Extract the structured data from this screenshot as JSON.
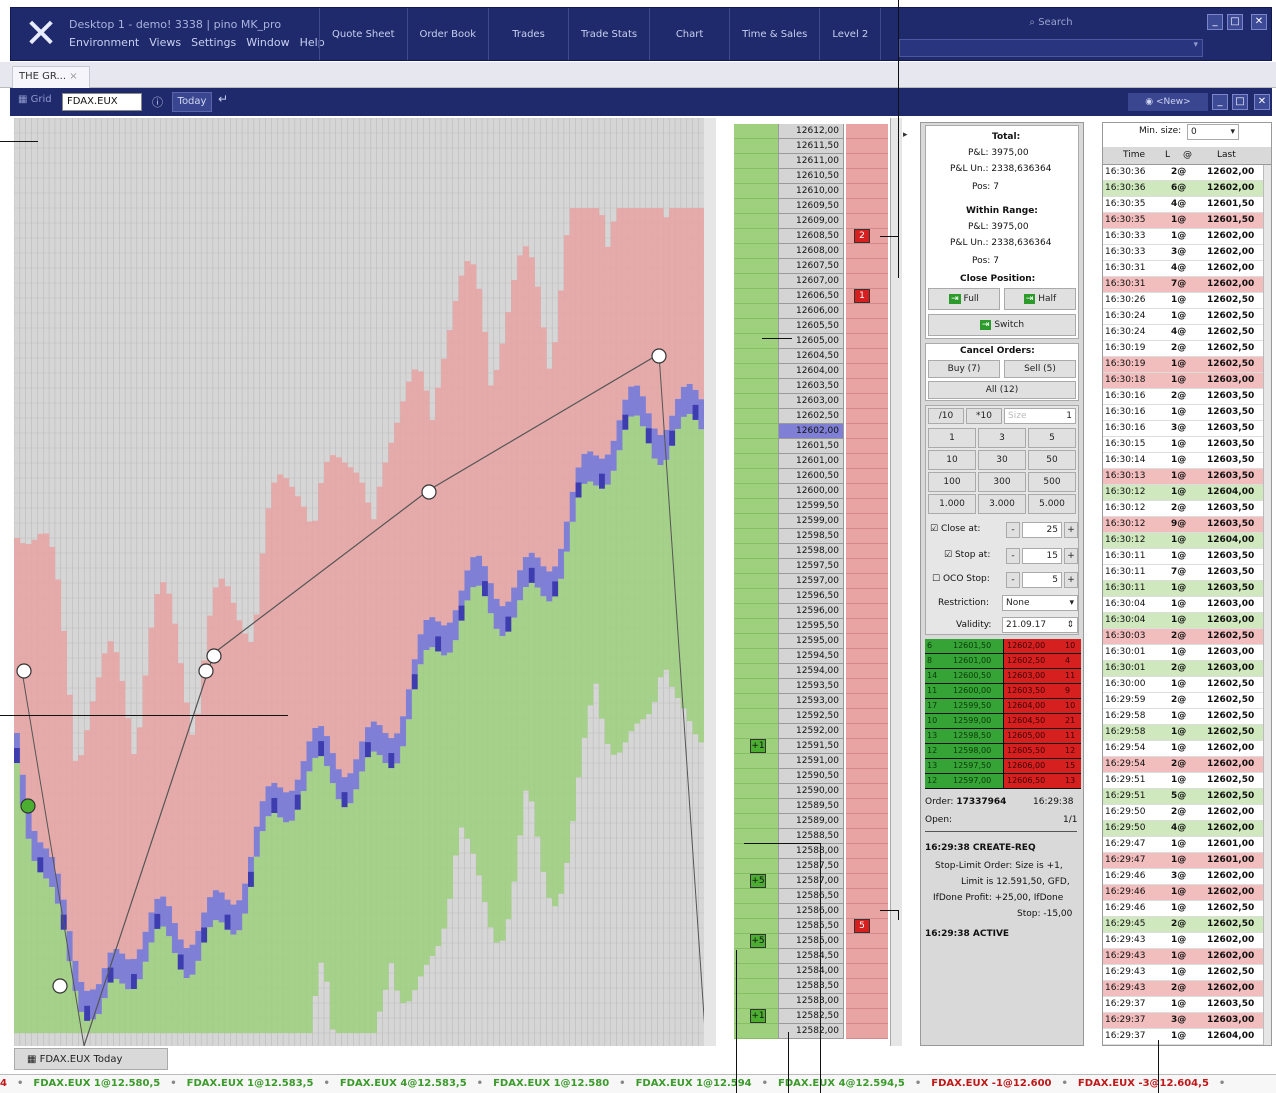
{
  "window": {
    "title": "Desktop 1 - demo! 3338 | pino MK_pro",
    "menu": [
      "Environment",
      "Views",
      "Settings",
      "Window",
      "Help"
    ],
    "buttons": [
      "Quote Sheet",
      "Order Book",
      "Trades",
      "Trade Stats",
      "Chart",
      "Time & Sales",
      "Level 2"
    ],
    "search_label": "Search"
  },
  "tab": {
    "label": "THE GR..."
  },
  "toolbar": {
    "grid_label": "Grid",
    "symbol": "FDAX.EUX",
    "today": "Today",
    "view": "<New>"
  },
  "ladder": {
    "prices": [
      "12612,00",
      "12611,50",
      "12611,00",
      "12610,50",
      "12610,00",
      "12609,50",
      "12609,00",
      "12608,50",
      "12608,00",
      "12607,50",
      "12607,00",
      "12606,50",
      "12606,00",
      "12605,50",
      "12605,00",
      "12604,50",
      "12604,00",
      "12603,50",
      "12603,00",
      "12602,50",
      "12602,00",
      "12601,50",
      "12601,00",
      "12600,50",
      "12600,00",
      "12599,50",
      "12599,00",
      "12598,50",
      "12598,00",
      "12597,50",
      "12597,00",
      "12596,50",
      "12596,00",
      "12595,50",
      "12595,00",
      "12594,50",
      "12594,00",
      "12593,50",
      "12593,00",
      "12592,50",
      "12592,00",
      "12591,50",
      "12591,00",
      "12590,50",
      "12590,00",
      "12589,50",
      "12589,00",
      "12588,50",
      "12588,00",
      "12587,50",
      "12587,00",
      "12586,50",
      "12586,00",
      "12585,50",
      "12585,00",
      "12584,50",
      "12584,00",
      "12583,50",
      "12583,00",
      "12582,50",
      "12582,00"
    ],
    "current_index": 20,
    "sell_markers": [
      {
        "row": 7,
        "label": "2"
      },
      {
        "row": 11,
        "label": "1"
      },
      {
        "row": 53,
        "label": "5"
      }
    ],
    "buy_markers": [
      {
        "row": 41,
        "label": "+1"
      },
      {
        "row": 50,
        "label": "+5"
      },
      {
        "row": 54,
        "label": "+5"
      },
      {
        "row": 59,
        "label": "+1"
      }
    ]
  },
  "panel": {
    "total_title": "Total:",
    "total_pnl": "P&L: 3975,00",
    "total_pnl_un": "P&L Un.: 2338,636364",
    "total_pos": "Pos: 7",
    "range_title": "Within Range:",
    "range_pnl": "P&L: 3975,00",
    "range_pnl_un": "P&L Un.: 2338,636364",
    "range_pos": "Pos: 7",
    "close_title": "Close Position:",
    "full": "Full",
    "half": "Half",
    "switch": "Switch",
    "cancel_title": "Cancel Orders:",
    "buy": "Buy (7)",
    "sell": "Sell (5)",
    "all": "All (12)",
    "qty_top": [
      "/10",
      "*10",
      "Size",
      "1"
    ],
    "qty": [
      "1",
      "3",
      "5",
      "10",
      "30",
      "50",
      "100",
      "300",
      "500",
      "1.000",
      "3.000",
      "5.000"
    ],
    "close_at": "Close at:",
    "close_at_val": "25",
    "stop_at": "Stop at:",
    "stop_at_val": "15",
    "oco_stop": "OCO Stop:",
    "oco_val": "5",
    "restriction": "Restriction:",
    "restriction_val": "None",
    "validity": "Validity:",
    "validity_val": "21.09.17",
    "book": [
      [
        "6",
        "12601,50",
        "12602,00",
        "10"
      ],
      [
        "8",
        "12601,00",
        "12602,50",
        "4"
      ],
      [
        "14",
        "12600,50",
        "12603,00",
        "11"
      ],
      [
        "11",
        "12600,00",
        "12603,50",
        "9"
      ],
      [
        "17",
        "12599,50",
        "12604,00",
        "10"
      ],
      [
        "10",
        "12599,00",
        "12604,50",
        "21"
      ],
      [
        "13",
        "12598,50",
        "12605,00",
        "11"
      ],
      [
        "12",
        "12598,00",
        "12605,50",
        "12"
      ],
      [
        "13",
        "12597,50",
        "12606,00",
        "15"
      ],
      [
        "12",
        "12597,00",
        "12606,50",
        "13"
      ]
    ],
    "order_label": "Order:",
    "order_id": "17337964",
    "order_time": "16:29:38",
    "open_label": "Open:",
    "open_val": "1/1",
    "log": [
      "16:29:38 CREATE-REQ",
      "Stop-Limit Order: Size is +1,",
      "Limit is 12.591,50, GFD,",
      "IfDone Profit: +25,00, IfDone",
      "Stop: -15,00",
      "16:29:38 ACTIVE"
    ]
  },
  "tas": {
    "min_size_label": "Min. size:",
    "min_size_val": "0",
    "headers": [
      "Time",
      "L",
      "@",
      "Last"
    ],
    "rows": [
      [
        "16:30:36",
        "2@",
        "12602,00",
        "w"
      ],
      [
        "16:30:36",
        "6@",
        "12602,00",
        "g"
      ],
      [
        "16:30:35",
        "4@",
        "12601,50",
        "w"
      ],
      [
        "16:30:35",
        "1@",
        "12601,50",
        "r"
      ],
      [
        "16:30:33",
        "1@",
        "12602,00",
        "w"
      ],
      [
        "16:30:33",
        "3@",
        "12602,00",
        "w"
      ],
      [
        "16:30:31",
        "4@",
        "12602,00",
        "w"
      ],
      [
        "16:30:31",
        "7@",
        "12602,00",
        "r"
      ],
      [
        "16:30:26",
        "1@",
        "12602,50",
        "w"
      ],
      [
        "16:30:24",
        "1@",
        "12602,50",
        "w"
      ],
      [
        "16:30:24",
        "4@",
        "12602,50",
        "w"
      ],
      [
        "16:30:19",
        "2@",
        "12602,50",
        "w"
      ],
      [
        "16:30:19",
        "1@",
        "12602,50",
        "r"
      ],
      [
        "16:30:18",
        "1@",
        "12603,00",
        "r"
      ],
      [
        "16:30:16",
        "2@",
        "12603,50",
        "w"
      ],
      [
        "16:30:16",
        "1@",
        "12603,50",
        "w"
      ],
      [
        "16:30:16",
        "3@",
        "12603,50",
        "w"
      ],
      [
        "16:30:15",
        "1@",
        "12603,50",
        "w"
      ],
      [
        "16:30:14",
        "1@",
        "12603,50",
        "w"
      ],
      [
        "16:30:13",
        "1@",
        "12603,50",
        "r"
      ],
      [
        "16:30:12",
        "1@",
        "12604,00",
        "g"
      ],
      [
        "16:30:12",
        "2@",
        "12603,50",
        "w"
      ],
      [
        "16:30:12",
        "9@",
        "12603,50",
        "r"
      ],
      [
        "16:30:12",
        "1@",
        "12604,00",
        "g"
      ],
      [
        "16:30:11",
        "1@",
        "12603,50",
        "w"
      ],
      [
        "16:30:11",
        "7@",
        "12603,50",
        "w"
      ],
      [
        "16:30:11",
        "1@",
        "12603,50",
        "g"
      ],
      [
        "16:30:04",
        "1@",
        "12603,00",
        "w"
      ],
      [
        "16:30:04",
        "1@",
        "12603,00",
        "g"
      ],
      [
        "16:30:03",
        "2@",
        "12602,50",
        "r"
      ],
      [
        "16:30:01",
        "1@",
        "12603,00",
        "w"
      ],
      [
        "16:30:01",
        "2@",
        "12603,00",
        "g"
      ],
      [
        "16:30:00",
        "1@",
        "12602,50",
        "w"
      ],
      [
        "16:29:59",
        "2@",
        "12602,50",
        "w"
      ],
      [
        "16:29:58",
        "1@",
        "12602,50",
        "w"
      ],
      [
        "16:29:58",
        "1@",
        "12602,50",
        "g"
      ],
      [
        "16:29:54",
        "1@",
        "12602,00",
        "w"
      ],
      [
        "16:29:54",
        "2@",
        "12602,00",
        "r"
      ],
      [
        "16:29:51",
        "1@",
        "12602,50",
        "w"
      ],
      [
        "16:29:51",
        "5@",
        "12602,50",
        "g"
      ],
      [
        "16:29:50",
        "2@",
        "12602,00",
        "w"
      ],
      [
        "16:29:50",
        "4@",
        "12602,00",
        "g"
      ],
      [
        "16:29:47",
        "1@",
        "12601,00",
        "w"
      ],
      [
        "16:29:47",
        "1@",
        "12601,00",
        "r"
      ],
      [
        "16:29:46",
        "3@",
        "12602,00",
        "w"
      ],
      [
        "16:29:46",
        "1@",
        "12602,00",
        "r"
      ],
      [
        "16:29:46",
        "1@",
        "12602,50",
        "w"
      ],
      [
        "16:29:45",
        "2@",
        "12602,50",
        "g"
      ],
      [
        "16:29:43",
        "1@",
        "12602,00",
        "w"
      ],
      [
        "16:29:43",
        "1@",
        "12602,00",
        "r"
      ],
      [
        "16:29:43",
        "1@",
        "12602,50",
        "w"
      ],
      [
        "16:29:43",
        "2@",
        "12602,00",
        "r"
      ],
      [
        "16:29:37",
        "1@",
        "12603,50",
        "w"
      ],
      [
        "16:29:37",
        "3@",
        "12603,00",
        "r"
      ],
      [
        "16:29:37",
        "1@",
        "12604,00",
        "w"
      ]
    ]
  },
  "bottom_tab": "FDAX.EUX Today",
  "ticker": [
    [
      "4",
      "r"
    ],
    [
      "FDAX.EUX 1@12.580,5",
      "g"
    ],
    [
      "FDAX.EUX 1@12.583,5",
      "g"
    ],
    [
      "FDAX.EUX 4@12.583,5",
      "g"
    ],
    [
      "FDAX.EUX 1@12.580",
      "g"
    ],
    [
      "FDAX.EUX 1@12.594",
      "g"
    ],
    [
      "FDAX.EUX 4@12.594,5",
      "g"
    ],
    [
      "FDAX.EUX -1@12.600",
      "r"
    ],
    [
      "FDAX.EUX -3@12.604,5",
      "r"
    ]
  ],
  "colors": {
    "navy": "#1f2a6d",
    "bid_green": "#9ed07e",
    "ask_red": "#e8a3a3",
    "trade_blue": "#7f7fd6"
  }
}
